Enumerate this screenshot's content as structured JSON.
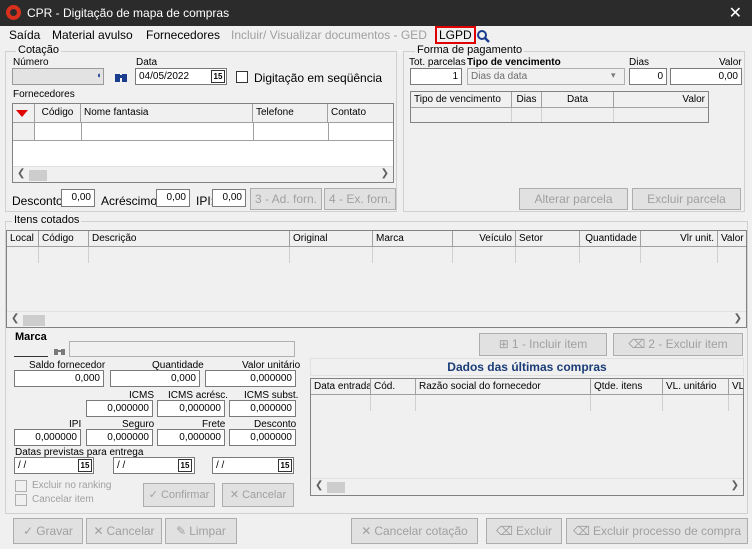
{
  "window": {
    "title": "CPR - Digitação de mapa de compras",
    "close": "✕"
  },
  "menu": [
    "Saída",
    "Material avulso",
    "Fornecedores",
    "Incluir/ Visualizar documentos - GED",
    "LGPD"
  ],
  "cotacao": {
    "group": "Cotação",
    "numero_label": "Número",
    "data_label": "Data",
    "data_value": "04/05/2022",
    "seq_label": "Digitação em seqüência",
    "fornecedores_label": "Fornecedores",
    "columns": [
      "Código",
      "Nome fantasia",
      "Telefone",
      "Contato"
    ],
    "desconto_label": "Desconto:",
    "desconto_value": "0,00",
    "acrescimo_label": "Acréscimo:",
    "acrescimo_value": "0,00",
    "ipi_label": "IPI:",
    "ipi_value": "0,00",
    "ad_forn": "3 - Ad. forn.",
    "ex_forn": "4 - Ex. forn."
  },
  "pagamento": {
    "group": "Forma de pagamento",
    "tot_label": "Tot. parcelas",
    "tot_value": "1",
    "tipo_label": "Tipo de vencimento",
    "tipo_value": "Dias da data",
    "dias_label": "Dias",
    "dias_value": "0",
    "valor_label": "Valor",
    "valor_value": "0,00",
    "columns": [
      "Tipo de vencimento",
      "Dias",
      "Data",
      "Valor"
    ],
    "alterar": "Alterar parcela",
    "excluir": "Excluir parcela"
  },
  "itens": {
    "group": "Itens cotados",
    "columns": [
      "Local",
      "Código",
      "Descrição",
      "Original",
      "Marca",
      "Veículo",
      "Setor",
      "Quantidade",
      "Vlr unit.",
      "Valor"
    ]
  },
  "detalhe": {
    "marca_label": "Marca",
    "saldo_label": "Saldo fornecedor",
    "saldo_value": "0,000",
    "qtd_label": "Quantidade",
    "qtd_value": "0,000",
    "vunit_label": "Valor unitário",
    "vunit_value": "0,000000",
    "icms_label": "ICMS",
    "icms_value": "0,000000",
    "icmsa_label": "ICMS acrésc.",
    "icmsa_value": "0,000000",
    "icmss_label": "ICMS subst.",
    "icmss_value": "0,000000",
    "ipi_label": "IPI",
    "ipi_value": "0,000000",
    "seguro_label": "Seguro",
    "seguro_value": "0,000000",
    "frete_label": "Frete",
    "frete_value": "0,000000",
    "desc_label": "Desconto",
    "desc_value": "0,000000",
    "datas_label": "Datas previstas para entrega",
    "date_empty": "/ /",
    "excluir_ranking": "Excluir no ranking",
    "cancelar_item": "Cancelar item",
    "confirmar": "Confirmar",
    "cancelar": "Cancelar",
    "incluir_item": "1 - Incluir item",
    "excluir_item": "2 - Excluir item"
  },
  "ultimas": {
    "title": "Dados das últimas compras",
    "columns": [
      "Data entrada",
      "Cód.",
      "Razão social do fornecedor",
      "Qtde. itens",
      "VL. unitário",
      "VL."
    ]
  },
  "footer": {
    "gravar": "Gravar",
    "cancelar": "Cancelar",
    "limpar": "Limpar",
    "cancelar_cotacao": "Cancelar cotação",
    "excluir": "Excluir",
    "excluir_processo": "Excluir processo de compra"
  }
}
